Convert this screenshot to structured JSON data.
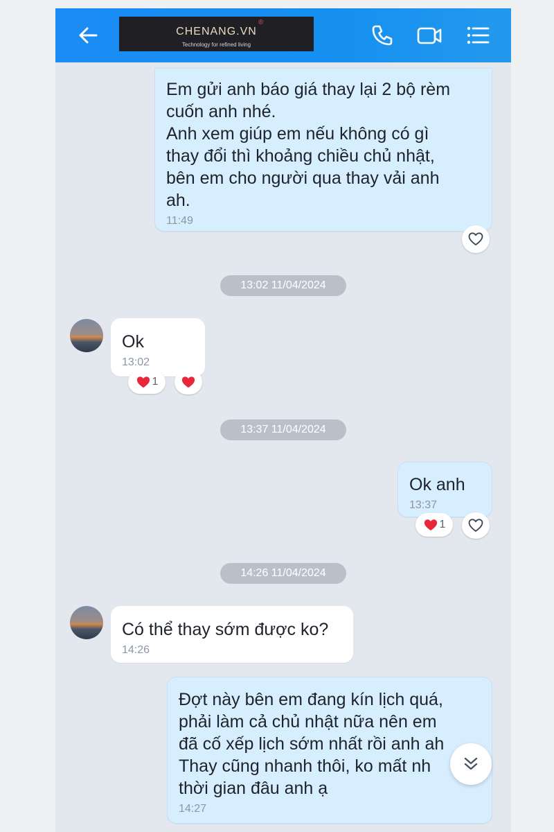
{
  "header": {
    "back_icon": "arrow-left-icon",
    "call_icon": "phone-icon",
    "video_icon": "video-call-icon",
    "menu_icon": "list-menu-icon",
    "background": "#1b8cf5"
  },
  "watermark": {
    "name": "CHENANG.VN",
    "registered": "®",
    "tagline": "Technology for refined living"
  },
  "messages": [
    {
      "sender": "me",
      "text": "Em gửi anh báo giá thay lại 2 bộ rèm\ncuốn anh nhé.\nAnh xem giúp em nếu không có gì\nthay đổi thì khoảng chiều chủ nhật,\nbên em cho người qua thay vải anh\nah.",
      "time": "11:49"
    },
    {
      "sender": "them",
      "text": "Ok",
      "time": "13:02",
      "reaction_count": "1"
    },
    {
      "sender": "me",
      "text": "Ok anh",
      "time": "13:37",
      "reaction_count": "1"
    },
    {
      "sender": "them",
      "text": "Có thể thay sớm được ko?",
      "time": "14:26"
    },
    {
      "sender": "me",
      "text": "Đợt này bên em đang kín lịch quá,\nphải làm cả chủ nhật nữa nên em\nđã cố xếp lịch sớm nhất rồi anh ah\nThay cũng nhanh thôi, ko mất nh\nthời gian đâu anh ạ",
      "time": "14:27"
    }
  ],
  "separators": [
    "13:02 11/04/2024",
    "13:37 11/04/2024",
    "14:26 11/04/2024"
  ],
  "colors": {
    "my_bubble": "#d7eeff",
    "their_bubble": "#ffffff",
    "chat_background": "#e3e8ef",
    "heart": "#e8283a"
  },
  "icons": {
    "like": "heart-outline-icon",
    "reaction": "heart-filled-icon",
    "scroll": "double-chevron-down-icon"
  }
}
